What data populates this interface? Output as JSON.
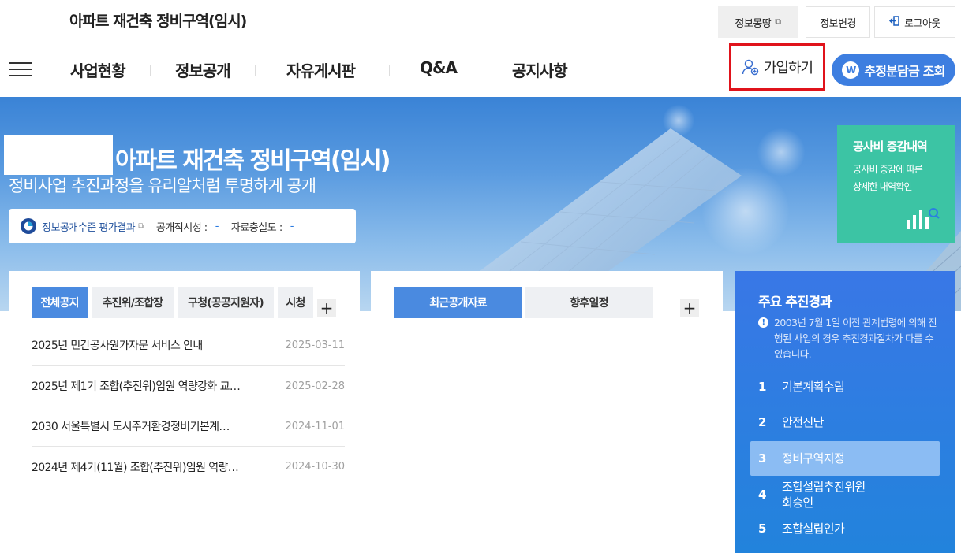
{
  "header": {
    "site_title": "아파트 재건축 정비구역(임시)",
    "info_map_label": "정보몽땅",
    "info_change_label": "정보변경",
    "logout_label": "로그아웃"
  },
  "nav": {
    "items": [
      "사업현황",
      "정보공개",
      "자유게시판",
      "Q&A",
      "공지사항"
    ],
    "join_label": "가입하기",
    "charge_label": "추정분담금 조회",
    "charge_badge": "W"
  },
  "hero": {
    "title": "아파트 재건축 정비구역(임시)",
    "subtitle": "정비사업 추진과정을 유리알처럼 투명하게 공개",
    "eval_link": "정보공개수준 평가결과",
    "timeliness_label": "공개적시성 :",
    "timeliness_value": "-",
    "fidelity_label": "자료충실도 :",
    "fidelity_value": "-",
    "cost_title": "공사비 증감내역",
    "cost_desc_1": "공사비 증감에 따른",
    "cost_desc_2": "상세한 내역확인"
  },
  "notice_panel": {
    "tabs": [
      "전체공지",
      "추진위/조합장",
      "구청(공공지원자)",
      "시청"
    ],
    "active_tab": 0,
    "plus": "+",
    "rows": [
      {
        "title": "2025년 민간공사원가자문 서비스 안내",
        "date": "2025-03-11"
      },
      {
        "title": "2025년 제1기 조합(추진위)임원 역량강화 교…",
        "date": "2025-02-28"
      },
      {
        "title": "2030 서울특별시 도시주거환경정비기본계…",
        "date": "2024-11-01"
      },
      {
        "title": "2024년 제4기(11월) 조합(추진위)임원 역량…",
        "date": "2024-10-30"
      }
    ]
  },
  "data_panel": {
    "tabs": [
      "최근공개자료",
      "향후일정"
    ],
    "active_tab": 0,
    "plus": "+"
  },
  "progress": {
    "title": "주요 추진경과",
    "note_icon": "!",
    "note": "2003년 7월 1일 이전 관계법령에 의해 진행된 사업의 경우 추진경과절차가 다를 수 있습니다.",
    "active_step": 3,
    "steps": [
      {
        "num": "1",
        "label": "기본계획수립"
      },
      {
        "num": "2",
        "label": "안전진단"
      },
      {
        "num": "3",
        "label": "정비구역지정"
      },
      {
        "num": "4",
        "label": "조합설립추진위원\n회승인"
      },
      {
        "num": "5",
        "label": "조합설립인가"
      }
    ]
  },
  "colors": {
    "primary": "#4a8ae0",
    "join_border": "#e0131b",
    "cost_green": "#3cc4a4",
    "progress_blue": "#2b7fe0"
  }
}
